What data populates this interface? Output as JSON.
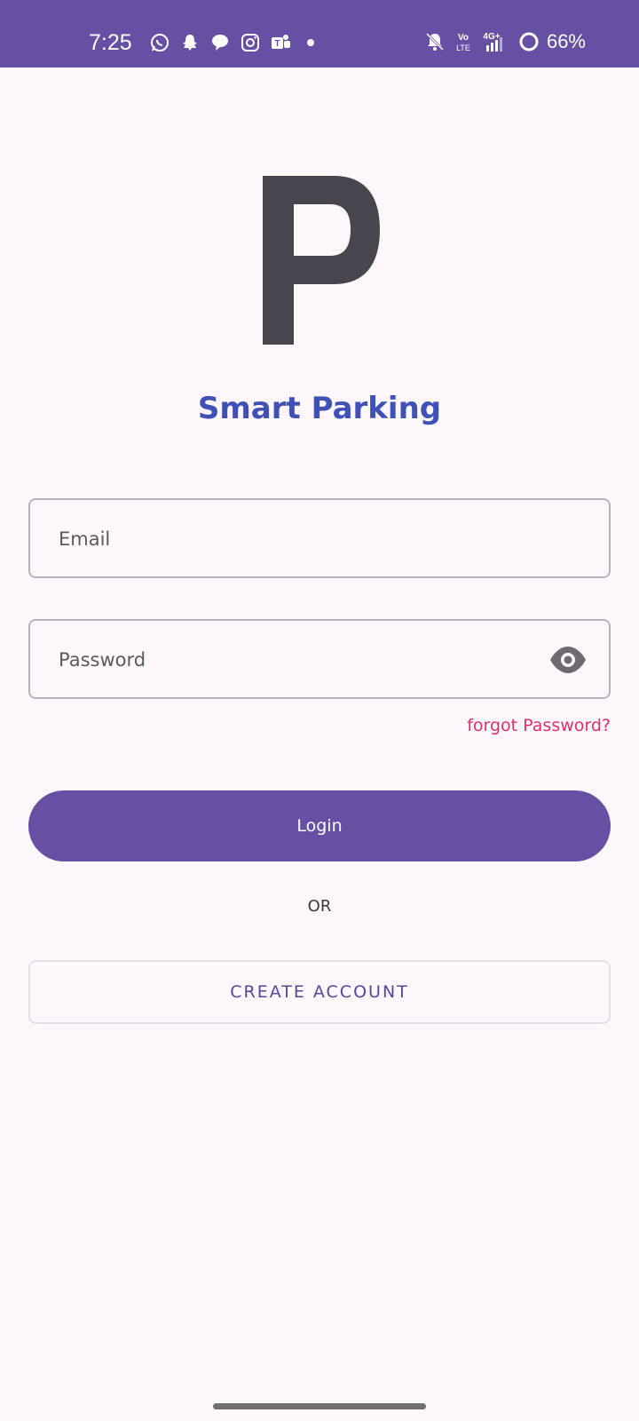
{
  "status_bar": {
    "time": "7:25",
    "battery": "66%",
    "left_icons": [
      "whatsapp-icon",
      "snapchat-icon",
      "chat-icon",
      "instagram-icon",
      "teams-icon",
      "dot-icon"
    ],
    "right_icons": [
      "bell-muted-icon",
      "volte-icon",
      "signal-4g-icon",
      "battery-icon"
    ],
    "network_labels": {
      "volte": "Vo LTE",
      "net": "4G+"
    },
    "background_color": "#6750a4"
  },
  "logo": {
    "letter": "P",
    "color": "#48454e"
  },
  "app_title": "Smart Parking",
  "form": {
    "email_placeholder": "Email",
    "password_placeholder": "Password",
    "forgot_password": "forgot Password?",
    "login_button": "Login",
    "or_text": "OR",
    "create_account_button": "CREATE ACCOUNT"
  },
  "colors": {
    "accent": "#6750a4",
    "title": "#3f51b5",
    "link": "#e0306b",
    "background": "#fdf6fb"
  }
}
